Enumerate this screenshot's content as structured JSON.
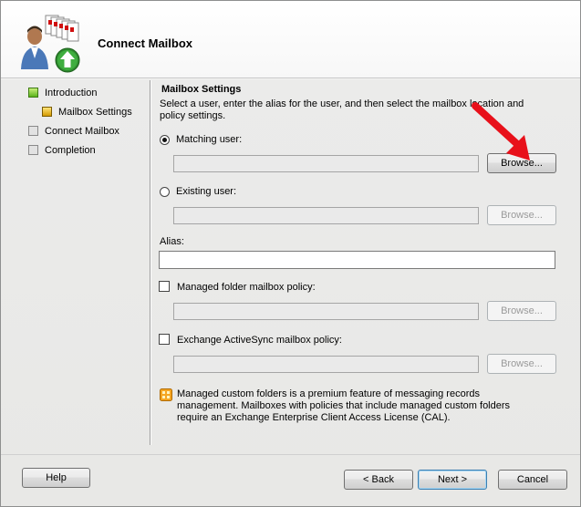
{
  "wizard": {
    "title": "Connect Mailbox"
  },
  "steps": [
    {
      "label": "Introduction",
      "state": "done"
    },
    {
      "label": "Mailbox Settings",
      "state": "current"
    },
    {
      "label": "Connect Mailbox",
      "state": "pending"
    },
    {
      "label": "Completion",
      "state": "pending"
    }
  ],
  "settings": {
    "section_title": "Mailbox Settings",
    "description": "Select a user, enter the alias for the user, and then select the mailbox location and policy settings.",
    "matching_user": {
      "label": "Matching user:",
      "selected": true,
      "value": "",
      "browse_label": "Browse...",
      "enabled": true
    },
    "existing_user": {
      "label": "Existing user:",
      "selected": false,
      "value": "",
      "browse_label": "Browse...",
      "enabled": false
    },
    "alias": {
      "label": "Alias:",
      "value": ""
    },
    "managed_folder_policy": {
      "label": "Managed folder mailbox policy:",
      "checked": false,
      "value": "",
      "browse_label": "Browse...",
      "enabled": false
    },
    "activesync_policy": {
      "label": "Exchange ActiveSync mailbox policy:",
      "checked": false,
      "value": "",
      "browse_label": "Browse...",
      "enabled": false
    },
    "info_text": "Managed custom folders is a premium feature of messaging records management. Mailboxes with policies that include managed custom folders require an Exchange Enterprise Client Access License (CAL)."
  },
  "buttons": {
    "help": "Help",
    "back": "< Back",
    "next": "Next >",
    "cancel": "Cancel"
  },
  "icons": {
    "wizard": "mailbox-users-upload-icon",
    "info": "info-icon",
    "annotation": "red-arrow-icon"
  },
  "colors": {
    "annotation_arrow": "#e8101a",
    "step_done": "#5bb31b",
    "step_current": "#d49a00"
  }
}
